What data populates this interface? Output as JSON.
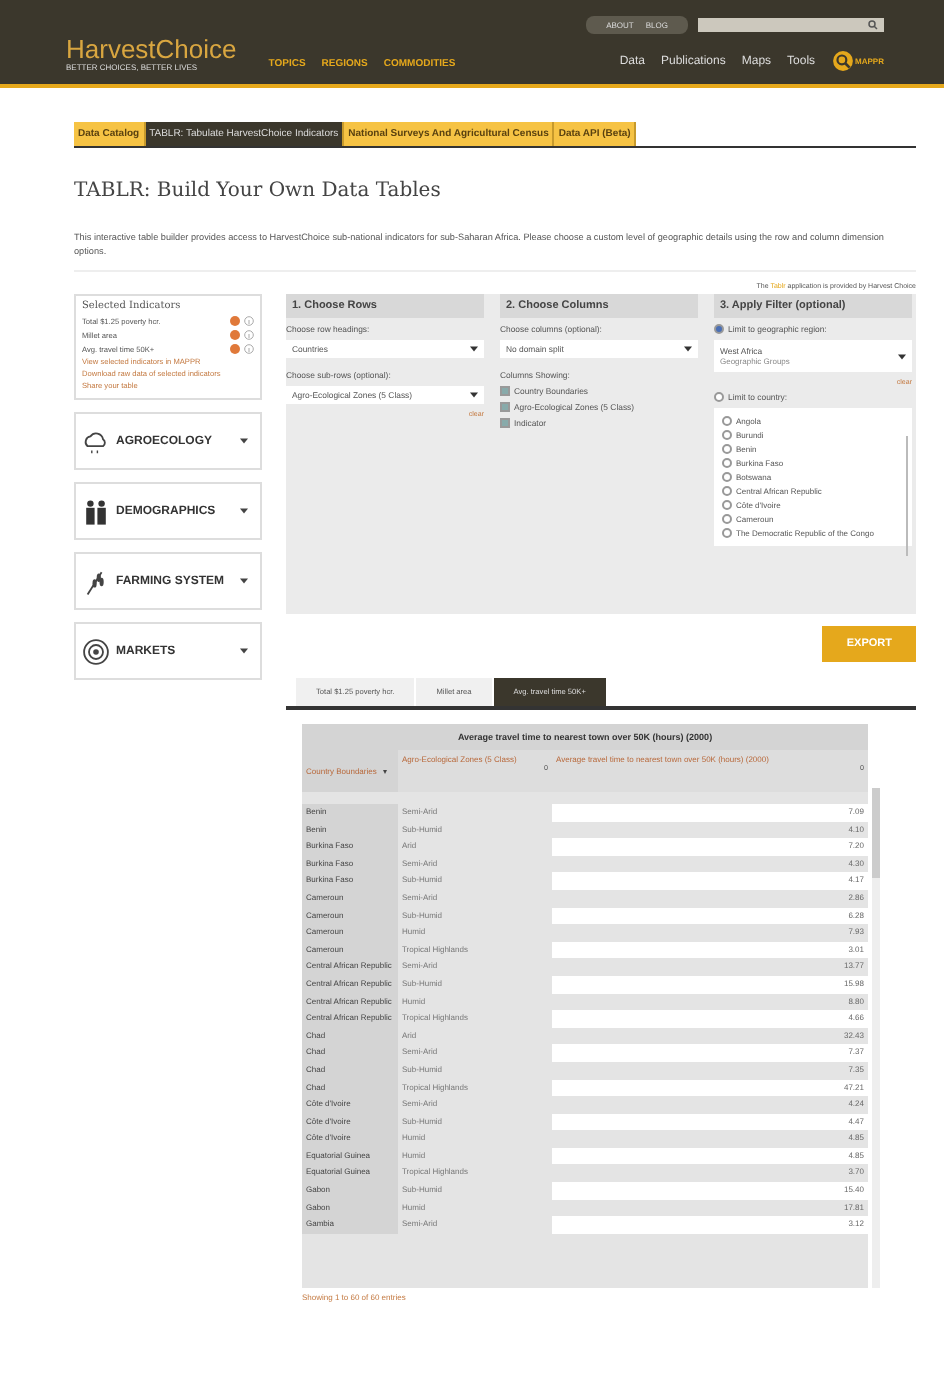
{
  "header": {
    "logo": "HarvestChoice",
    "tagline": "BETTER CHOICES, BETTER LIVES",
    "top_links": [
      "ABOUT",
      "BLOG"
    ],
    "nav_main": [
      "TOPICS",
      "REGIONS",
      "COMMODITIES"
    ],
    "nav_right": [
      "Data",
      "Publications",
      "Maps",
      "Tools"
    ],
    "mappr": "MAPPR"
  },
  "tabs": [
    {
      "label": "Data Catalog",
      "selected": false
    },
    {
      "label": "TABLR: Tabulate HarvestChoice Indicators",
      "selected": true
    },
    {
      "label": "National Surveys And Agricultural Census",
      "selected": false
    },
    {
      "label": "Data API (Beta)",
      "selected": false
    }
  ],
  "title": "TABLR: Build Your Own Data Tables",
  "intro": "This interactive table builder provides access to HarvestChoice sub-national indicators for sub-Saharan Africa. Please choose a custom level of geographic details using the row and column dimension options.",
  "credit": {
    "before": "The",
    "link": "Tablr",
    "after": "application is provided by Harvest Choice"
  },
  "selected_indicators": {
    "title": "Selected Indicators",
    "items": [
      "Total $1.25 poverty hcr.",
      "Millet area",
      "Avg. travel time 50K+"
    ],
    "links": [
      "View selected indicators in MAPPR",
      "Download raw data of selected indicators",
      "Share your table"
    ]
  },
  "categories": [
    {
      "label": "AGROECOLOGY",
      "kind": "cloud"
    },
    {
      "label": "DEMOGRAPHICS",
      "kind": "people"
    },
    {
      "label": "FARMING SYSTEM",
      "kind": "wheat"
    },
    {
      "label": "MARKETS",
      "kind": "target"
    }
  ],
  "rows_panel": {
    "title": "1. Choose Rows",
    "heading_label": "Choose row headings:",
    "heading_value": "Countries",
    "sub_label": "Choose sub-rows (optional):",
    "sub_value": "Agro-Ecological Zones (5 Class)",
    "clear": "clear"
  },
  "columns_panel": {
    "title": "2. Choose Columns",
    "label": "Choose columns (optional):",
    "value": "No domain split",
    "showing_label": "Columns Showing:",
    "showing": [
      {
        "label": "Country Boundaries",
        "checked": true
      },
      {
        "label": "Agro-Ecological Zones (5 Class)",
        "checked": true
      },
      {
        "label": "Indicator",
        "checked": true
      }
    ]
  },
  "filter_panel": {
    "title": "3. Apply Filter (optional)",
    "region_label": "Limit to geographic region:",
    "region_selected": true,
    "region_value": "West Africa",
    "region_sub": "Geographic Groups",
    "clear": "clear",
    "country_label": "Limit to country:",
    "country_selected": false,
    "countries": [
      {
        "name": "Angola",
        "selected": false
      },
      {
        "name": "Burundi",
        "selected": false
      },
      {
        "name": "Benin",
        "selected": false
      },
      {
        "name": "Burkina Faso",
        "selected": false
      },
      {
        "name": "Botswana",
        "selected": false
      },
      {
        "name": "Central African Republic",
        "selected": false
      },
      {
        "name": "Côte d'Ivoire",
        "selected": false
      },
      {
        "name": "Cameroun",
        "selected": false
      },
      {
        "name": "The Democratic Republic of the Congo",
        "selected": false
      }
    ]
  },
  "export": "EXPORT",
  "result_tabs": [
    {
      "label": "Total $1.25 poverty hcr.",
      "selected": false
    },
    {
      "label": "Millet area",
      "selected": false
    },
    {
      "label": "Avg. travel time 50K+",
      "selected": true
    }
  ],
  "table": {
    "title": "Average travel time to nearest town over 50K (hours) (2000)",
    "columns": [
      {
        "label": "Country Boundaries",
        "sort": "▾"
      },
      {
        "label": "Agro-Ecological Zones (5 Class)",
        "total": "0"
      },
      {
        "label": "Average travel time to nearest town over 50K (hours) (2000)",
        "total": "0"
      }
    ],
    "rows": [
      [
        "Benin",
        "Semi-Arid",
        "7.09"
      ],
      [
        "Benin",
        "Sub-Humid",
        "4.10"
      ],
      [
        "Burkina Faso",
        "Arid",
        "7.20"
      ],
      [
        "Burkina Faso",
        "Semi-Arid",
        "4.30"
      ],
      [
        "Burkina Faso",
        "Sub-Humid",
        "4.17"
      ],
      [
        "Cameroun",
        "Semi-Arid",
        "2.86"
      ],
      [
        "Cameroun",
        "Sub-Humid",
        "6.28"
      ],
      [
        "Cameroun",
        "Humid",
        "7.93"
      ],
      [
        "Cameroun",
        "Tropical Highlands",
        "3.01"
      ],
      [
        "Central African Republic",
        "Semi-Arid",
        "13.77"
      ],
      [
        "Central African Republic",
        "Sub-Humid",
        "15.98"
      ],
      [
        "Central African Republic",
        "Humid",
        "8.80"
      ],
      [
        "Central African Republic",
        "Tropical Highlands",
        "4.66"
      ],
      [
        "Chad",
        "Arid",
        "32.43"
      ],
      [
        "Chad",
        "Semi-Arid",
        "7.37"
      ],
      [
        "Chad",
        "Sub-Humid",
        "7.35"
      ],
      [
        "Chad",
        "Tropical Highlands",
        "47.21"
      ],
      [
        "Côte d'Ivoire",
        "Semi-Arid",
        "4.24"
      ],
      [
        "Côte d'Ivoire",
        "Sub-Humid",
        "4.47"
      ],
      [
        "Côte d'Ivoire",
        "Humid",
        "4.85"
      ],
      [
        "Equatorial Guinea",
        "Humid",
        "4.85"
      ],
      [
        "Equatorial Guinea",
        "Tropical Highlands",
        "3.70"
      ],
      [
        "Gabon",
        "Sub-Humid",
        "15.40"
      ],
      [
        "Gabon",
        "Humid",
        "17.81"
      ],
      [
        "Gambia",
        "Semi-Arid",
        "3.12"
      ]
    ],
    "footer": "Showing 1 to 60 of 60 entries"
  }
}
